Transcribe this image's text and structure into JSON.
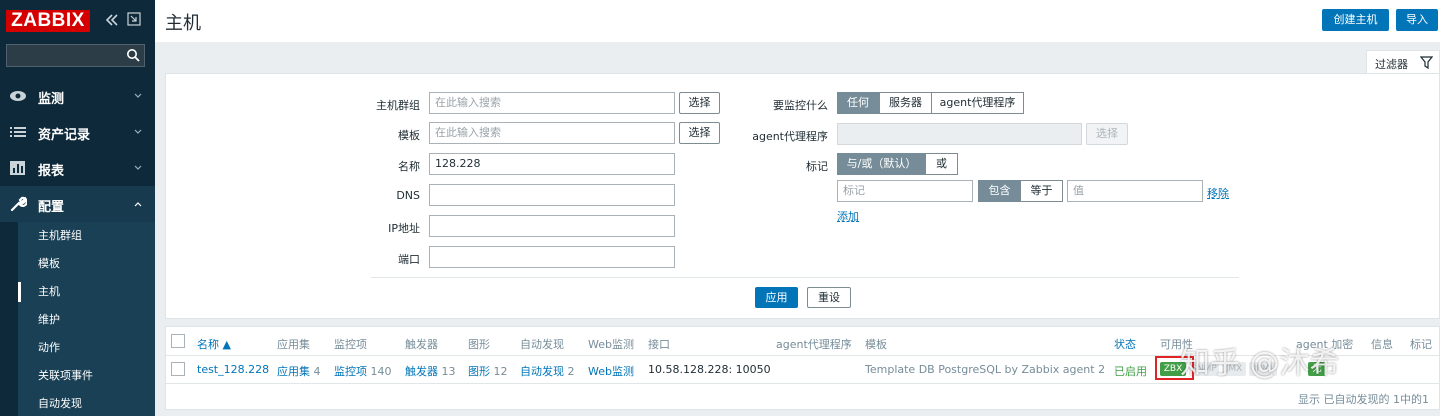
{
  "app": {
    "logo": "ZABBIX"
  },
  "sidebar": {
    "menu": [
      {
        "label": "监测",
        "icon": "eye-icon"
      },
      {
        "label": "资产记录",
        "icon": "list-icon"
      },
      {
        "label": "报表",
        "icon": "bar-chart-icon"
      },
      {
        "label": "配置",
        "icon": "wrench-icon",
        "expanded": true
      }
    ],
    "submenu": [
      "主机群组",
      "模板",
      "主机",
      "维护",
      "动作",
      "关联项事件",
      "自动发现"
    ],
    "selected_submenu": "主机"
  },
  "header": {
    "title": "主机",
    "create_button": "创建主机",
    "import_button": "导入"
  },
  "filter": {
    "tab_label": "过滤器",
    "host_groups_label": "主机群组",
    "host_groups_placeholder": "在此输入搜索",
    "templates_label": "模板",
    "templates_placeholder": "在此输入搜索",
    "select_button": "选择",
    "name_label": "名称",
    "name_value": "128.228",
    "dns_label": "DNS",
    "ip_label": "IP地址",
    "port_label": "端口",
    "monitored_by_label": "要监控什么",
    "monitored_by_options": [
      "任何",
      "服务器",
      "agent代理程序"
    ],
    "proxy_label": "agent代理程序",
    "proxy_select": "选择",
    "tags_label": "标记",
    "tags_mode": [
      "与/或（默认）",
      "或"
    ],
    "tag_placeholder": "标记",
    "tag_operators": [
      "包含",
      "等于"
    ],
    "value_placeholder": "值",
    "remove_link": "移除",
    "add_link": "添加",
    "apply_button": "应用",
    "reset_button": "重设"
  },
  "table": {
    "headers": [
      "名称 ▲",
      "应用集",
      "监控项",
      "触发器",
      "图形",
      "自动发现",
      "Web监测",
      "接口",
      "agent代理程序",
      "模板",
      "状态",
      "可用性",
      "agent 加密",
      "信息",
      "标记"
    ],
    "rows": [
      {
        "name": "test_128.228",
        "apps": "应用集",
        "apps_count": "4",
        "items": "监控项",
        "items_count": "140",
        "triggers": "触发器",
        "triggers_count": "13",
        "graphs": "图形",
        "graphs_count": "12",
        "discovery": "自动发现",
        "discovery_count": "2",
        "web": "Web监测",
        "interface": "10.58.128.228: 10050",
        "template": "Template DB PostgreSQL by Zabbix agent 2",
        "status": "已启用",
        "availability": [
          "ZBX",
          "SNMP",
          "JMX",
          "IPMI"
        ],
        "encryption": "无"
      }
    ],
    "paging": "显示 已自动发现的 1中的1"
  },
  "watermark": "知乎 @沐希",
  "colors": {
    "brand": "#d40000",
    "accent": "#0275b8",
    "sidebar": "#0e2a3a",
    "ok": "#429e47"
  }
}
